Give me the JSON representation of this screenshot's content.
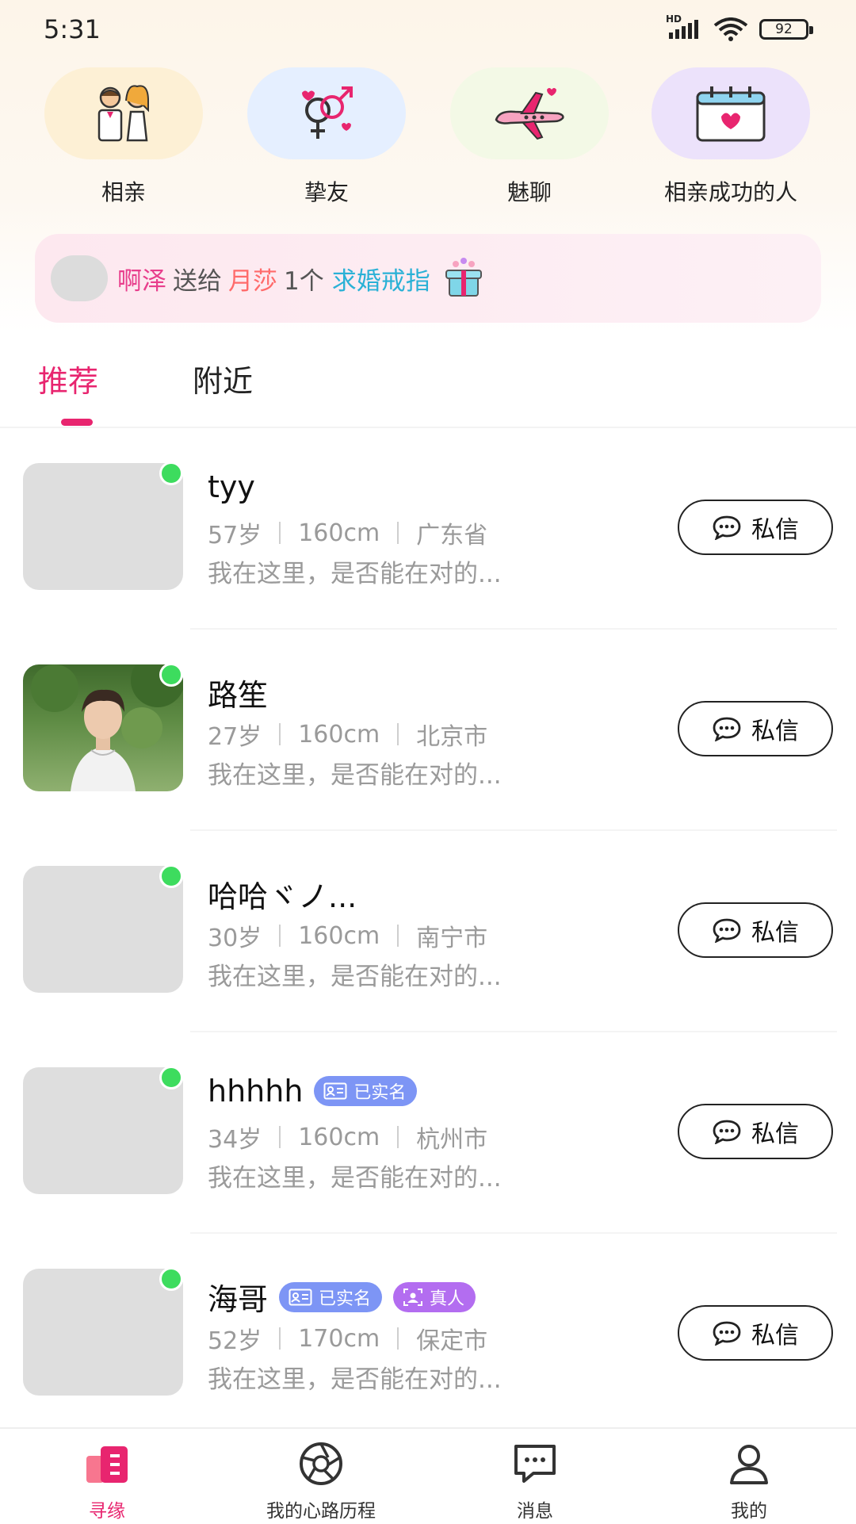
{
  "status_bar": {
    "time": "5:31",
    "battery": "92",
    "network_label": "HD"
  },
  "categories": [
    {
      "label": "相亲",
      "icon": "couple-icon",
      "bg": "#fdf0d5"
    },
    {
      "label": "挚友",
      "icon": "gender-symbols-icon",
      "bg": "#e5efff"
    },
    {
      "label": "魅聊",
      "icon": "airplane-icon",
      "bg": "#f3f9e6"
    },
    {
      "label": "相亲成功的人",
      "icon": "calendar-heart-icon",
      "bg": "#ece2fb"
    }
  ],
  "gift_banner": {
    "sender": "啊泽",
    "action": "送给",
    "receiver": "月莎",
    "count": "1个",
    "item": "求婚戒指"
  },
  "tabs": [
    {
      "label": "推荐"
    },
    {
      "label": "附近"
    }
  ],
  "users": [
    {
      "name": "tyy",
      "age": "57岁",
      "height": "160cm",
      "location": "广东省",
      "bio": "我在这里，是否能在对的...",
      "badges": [],
      "has_photo": false
    },
    {
      "name": "路笙",
      "age": "27岁",
      "height": "160cm",
      "location": "北京市",
      "bio": "我在这里，是否能在对的...",
      "badges": [],
      "has_photo": true
    },
    {
      "name": "哈哈ヾノ...",
      "age": "30岁",
      "height": "160cm",
      "location": "南宁市",
      "bio": "我在这里，是否能在对的...",
      "badges": [],
      "has_photo": false
    },
    {
      "name": "hhhhh",
      "age": "34岁",
      "height": "160cm",
      "location": "杭州市",
      "bio": "我在这里，是否能在对的...",
      "badges": [
        "已实名"
      ],
      "has_photo": false
    },
    {
      "name": "海哥",
      "age": "52岁",
      "height": "170cm",
      "location": "保定市",
      "bio": "我在这里，是否能在对的...",
      "badges": [
        "已实名",
        "真人"
      ],
      "has_photo": false
    }
  ],
  "message_button": {
    "label": "私信"
  },
  "bottom_nav": [
    {
      "label": "寻缘",
      "icon": "cards-icon",
      "active": true
    },
    {
      "label": "我的心路历程",
      "icon": "aperture-icon",
      "active": false
    },
    {
      "label": "消息",
      "icon": "chat-icon",
      "active": false
    },
    {
      "label": "我的",
      "icon": "profile-icon",
      "active": false
    }
  ],
  "colors": {
    "accent": "#e8256f",
    "online": "#3ddc5e",
    "badge_real": "#7d95f5",
    "badge_human": "#b36df0"
  }
}
